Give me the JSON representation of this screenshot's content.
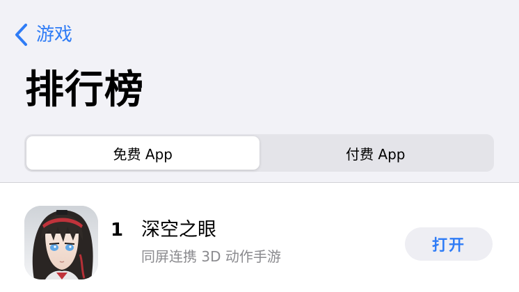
{
  "nav": {
    "back_label": "游戏",
    "back_icon": "chevron-left-icon"
  },
  "page": {
    "title": "排行榜"
  },
  "segments": {
    "free_label": "免费 App",
    "paid_label": "付费 App",
    "selected": "free"
  },
  "apps": [
    {
      "rank": "1",
      "name": "深空之眼",
      "subtitle": "同屏连携 3D 动作手游",
      "button_label": "打开",
      "icon": "app-icon-anime-character"
    }
  ],
  "colors": {
    "accent": "#2f7cf6",
    "header_background": "#f2f2f7",
    "segment_track": "#e4e4e9",
    "button_background": "#eeeef3",
    "secondary_text": "#8a8a8e"
  }
}
